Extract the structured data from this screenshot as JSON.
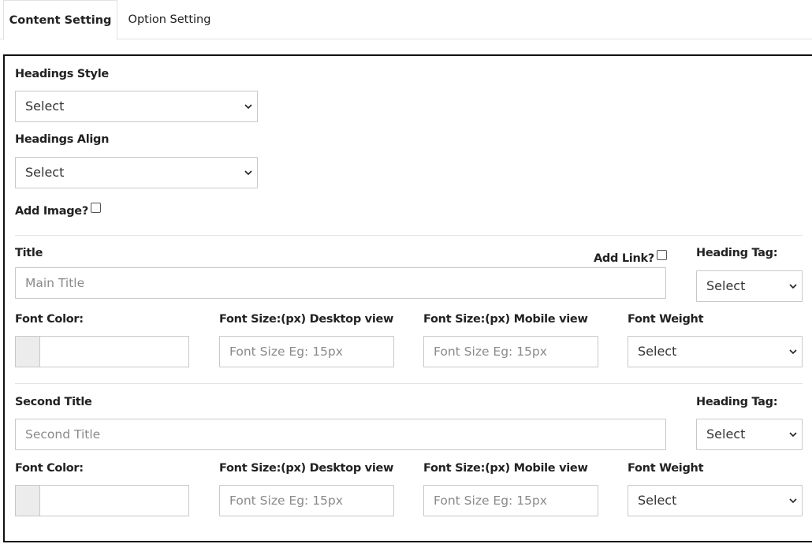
{
  "tabs": [
    {
      "label": "Content Setting",
      "active": true
    },
    {
      "label": "Option Setting",
      "active": false
    }
  ],
  "form": {
    "headings_style": {
      "label": "Headings Style",
      "value": "Select"
    },
    "headings_align": {
      "label": "Headings Align",
      "value": "Select"
    },
    "add_image": {
      "label": "Add Image?",
      "checked": false
    },
    "title_section": {
      "title_label": "Title",
      "title_placeholder": "Main Title",
      "add_link_label": "Add Link?",
      "add_link_checked": false,
      "heading_tag_label": "Heading Tag:",
      "heading_tag_value": "Select",
      "font_color_label": "Font Color:",
      "font_size_desktop_label": "Font Size:(px) Desktop view",
      "font_size_desktop_placeholder": "Font Size Eg: 15px",
      "font_size_mobile_label": "Font Size:(px) Mobile view",
      "font_size_mobile_placeholder": "Font Size Eg: 15px",
      "font_weight_label": "Font Weight",
      "font_weight_value": "Select"
    },
    "second_title_section": {
      "title_label": "Second Title",
      "title_placeholder": "Second Title",
      "heading_tag_label": "Heading Tag:",
      "heading_tag_value": "Select",
      "font_color_label": "Font Color:",
      "font_size_desktop_label": "Font Size:(px) Desktop view",
      "font_size_desktop_placeholder": "Font Size Eg: 15px",
      "font_size_mobile_label": "Font Size:(px) Mobile view",
      "font_size_mobile_placeholder": "Font Size Eg: 15px",
      "font_weight_label": "Font Weight",
      "font_weight_value": "Select"
    }
  },
  "icons": {
    "select_arrow": "chevron-down-icon",
    "color_swatch": "color-swatch"
  },
  "colors": {
    "border": "#c8c8c8",
    "panel_border": "#111111",
    "swatch": "#ececec",
    "placeholder": "#8a8a8a"
  }
}
